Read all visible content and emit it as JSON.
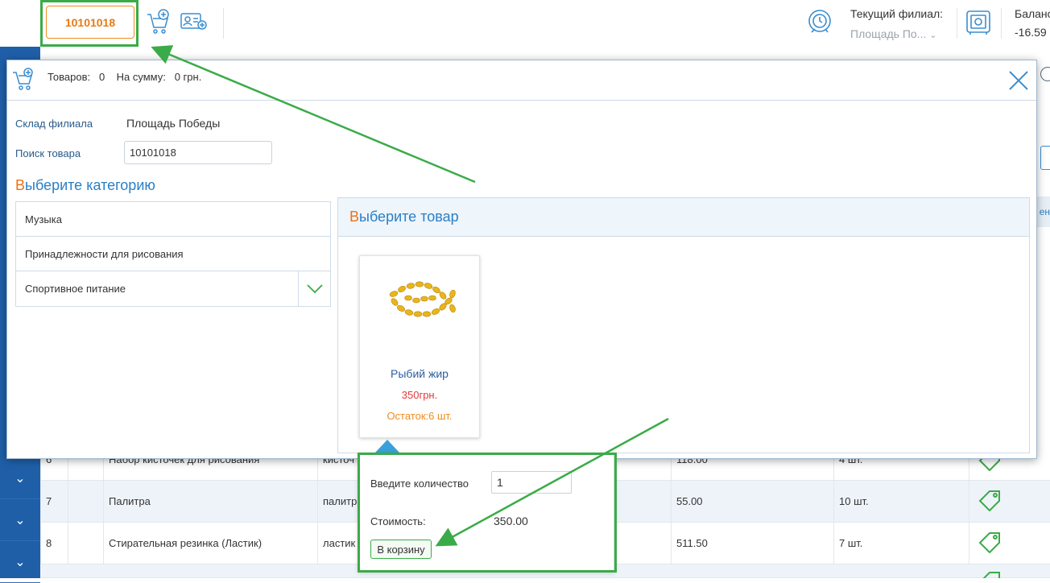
{
  "header": {
    "barcode_value": "10101018",
    "branch_title": "Текущий филиал:",
    "branch_value": "Площадь По...",
    "balance_title": "Баланс",
    "balance_value": "-16.59"
  },
  "background_table": {
    "rows": [
      {
        "num": "6",
        "name": "Набор кисточек для рисования",
        "code": "кисточ",
        "price": "118.00",
        "stock": "4 шт."
      },
      {
        "num": "7",
        "name": "Палитра",
        "code": "палитр",
        "price": "55.00",
        "stock": "10 шт."
      },
      {
        "num": "8",
        "name": "Стирательная резинка (Ластик)",
        "code": "ластик",
        "price": "511.50",
        "stock": "7 шт."
      }
    ],
    "header_fragment": "ен"
  },
  "modal": {
    "goods_label": "Товаров:",
    "goods_count": "0",
    "sum_label": "На сумму:",
    "sum_value": "0 грн.",
    "warehouse_label": "Склад филиала",
    "warehouse_value": "Площадь Победы",
    "search_label": "Поиск товара",
    "search_value": "10101018",
    "category_heading_first": "В",
    "category_heading_rest": "ыберите категорию",
    "categories": [
      "Музыка",
      "Принадлежности для рисования",
      "Спортивное питание"
    ],
    "product_heading_first": "В",
    "product_heading_rest": "ыберите товар",
    "product": {
      "name": "Рыбий жир",
      "price": "350грн.",
      "stock": "Остаток:6 шт."
    }
  },
  "popover": {
    "qty_label": "Введите количество",
    "qty_value": "1",
    "cost_label": "Стоимость:",
    "cost_value": "350.00",
    "add_button": "В корзину"
  },
  "colors": {
    "accent_orange": "#f07016",
    "accent_blue": "#2a7fc6",
    "highlight_green": "#3aab48",
    "sidebar_blue": "#1f5fa8",
    "price_red": "#e03a3a",
    "stock_orange": "#f08c1e"
  },
  "icons": [
    "add-to-cart-icon",
    "add-client-icon",
    "branch-clock-icon",
    "safe-icon",
    "close-icon",
    "chevron-down-icon",
    "price-tag-icon",
    "fish-oil-image"
  ]
}
